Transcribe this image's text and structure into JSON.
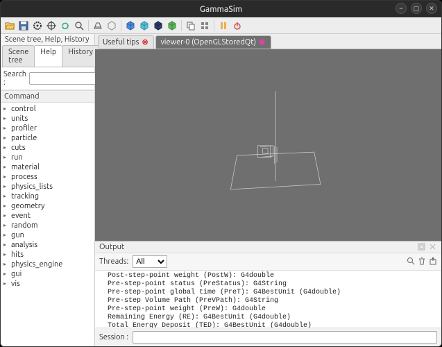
{
  "window": {
    "title": "GammaSim"
  },
  "toolbar_icons": [
    "open",
    "save",
    "gear",
    "target",
    "refresh",
    "search",
    "perspective",
    "scene",
    "cube-blue",
    "cube-cyan",
    "cube-navy",
    "cube-green",
    "copy",
    "grid",
    "pause",
    "power"
  ],
  "left": {
    "title": "Scene tree, Help, History",
    "tabs": [
      "Scene tree",
      "Help",
      "History"
    ],
    "active_tab": 1,
    "search_label": "Search :",
    "search_value": "",
    "command_header": "Command",
    "tree": [
      "control",
      "units",
      "profiler",
      "particle",
      "cuts",
      "run",
      "material",
      "process",
      "physics_lists",
      "tracking",
      "geometry",
      "event",
      "random",
      "gun",
      "analysis",
      "hits",
      "physics_engine",
      "gui",
      "vis"
    ]
  },
  "viewer_tabs": [
    {
      "label": "Useful tips",
      "active": false
    },
    {
      "label": "viewer-0 (OpenGLStoredQt)",
      "active": true
    }
  ],
  "output": {
    "header": "Output",
    "threads_label": "Threads:",
    "threads_value": "All",
    "text": "  Post-step-point weight (PostW): G4double\n  Pre-step-point status (PreStatus): G4String\n  Pre-step-point global time (PreT): G4BestUnit (G4double)\n  Pre-step Volume Path (PreVPath): G4String\n  Pre-step-point weight (PreW): G4double\n  Remaining Energy (RE): G4BestUnit (G4double)\n  Total Energy Deposit (TED): G4BestUnit (G4double)\nWARNING: Trajectory storing has been requested.  This action may be\n  reversed with \"/tracking/storeTrajectory 0\".\nChanging export format to \"jpg\""
  },
  "session": {
    "label": "Session :",
    "value": ""
  }
}
